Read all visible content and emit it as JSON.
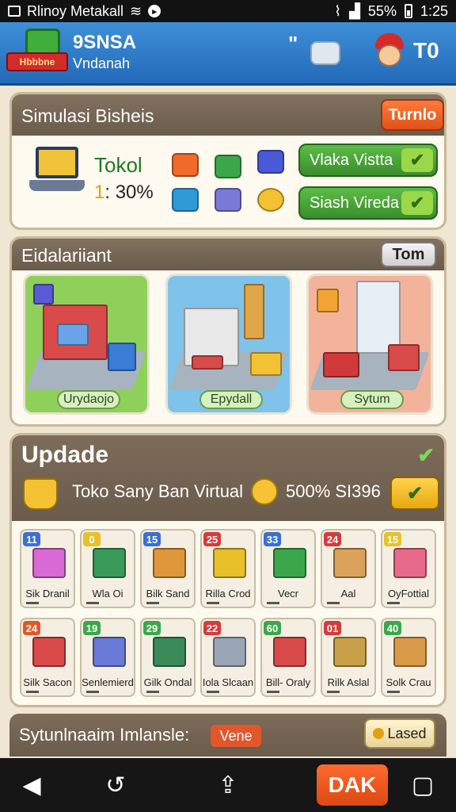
{
  "status_bar": {
    "carrier": "Rlinoy Metakall",
    "battery": "55%",
    "time": "1:25"
  },
  "header": {
    "badge_text": "Hbbbne",
    "title": "9SNSA",
    "subtitle": "Vndanah",
    "quote_mark": "\"",
    "score": "T0"
  },
  "simulation": {
    "title": "Simulasi Bisheis",
    "action_label": "Turnlo",
    "stat_label": "Tokol",
    "stat_prefix": "1",
    "stat_value": ": 30%",
    "buttons": [
      {
        "label": "Vlaka Vistta",
        "check": "✔"
      },
      {
        "label": "Siash Vireda",
        "check": "✔"
      }
    ]
  },
  "city": {
    "title": "Eidalariiant",
    "action_label": "Tom",
    "cards": [
      {
        "label": "Urydaojo"
      },
      {
        "label": "Epydall"
      },
      {
        "label": "Sytum"
      }
    ]
  },
  "update": {
    "title": "Updade",
    "check": "✔",
    "line_text": "Toko Sany Ban Virtual",
    "amount": "500%  SI396",
    "button_check": "✔",
    "tiles": [
      {
        "num": "11",
        "label": "Sik Dranil",
        "color": "#3a6fd6"
      },
      {
        "num": "0",
        "label": "Wla Oi",
        "color": "#e8c12a"
      },
      {
        "num": "15",
        "label": "Bilk Sand",
        "color": "#3a6fd6"
      },
      {
        "num": "25",
        "label": "Rilla Crod",
        "color": "#d63a3a"
      },
      {
        "num": "33",
        "label": "Vecr",
        "color": "#3a6fd6"
      },
      {
        "num": "24",
        "label": "Aal",
        "color": "#d63a3a"
      },
      {
        "num": "15",
        "label": "OyFottial",
        "color": "#e8c12a"
      },
      {
        "num": "24",
        "label": "Silk Sacon",
        "color": "#e2572a"
      },
      {
        "num": "19",
        "label": "Senlemierd",
        "color": "#3aa84a"
      },
      {
        "num": "29",
        "label": "Gilk Ondal",
        "color": "#3aa84a"
      },
      {
        "num": "22",
        "label": "Iola Slcaan",
        "color": "#d63a3a"
      },
      {
        "num": "60",
        "label": "Bill- Oraly",
        "color": "#3aa84a"
      },
      {
        "num": "01",
        "label": "Rilk Aslal",
        "color": "#d63a3a"
      },
      {
        "num": "40",
        "label": "Solk Crau",
        "color": "#3aa84a"
      }
    ]
  },
  "footer_panel": {
    "title": "Sytunlnaaim Imlansle:",
    "tag": "Vene",
    "button_label": "Lased"
  },
  "navbar": {
    "back_icon": "◀",
    "refresh_icon": "↺",
    "share_icon": "⇪",
    "cta_label": "DAK",
    "recent_icon": "▢"
  },
  "colors": {
    "header_blue": "#2f7ccb",
    "panel_brown": "#74644f",
    "accent_orange": "#e8622a",
    "accent_green": "#4aa63a"
  }
}
